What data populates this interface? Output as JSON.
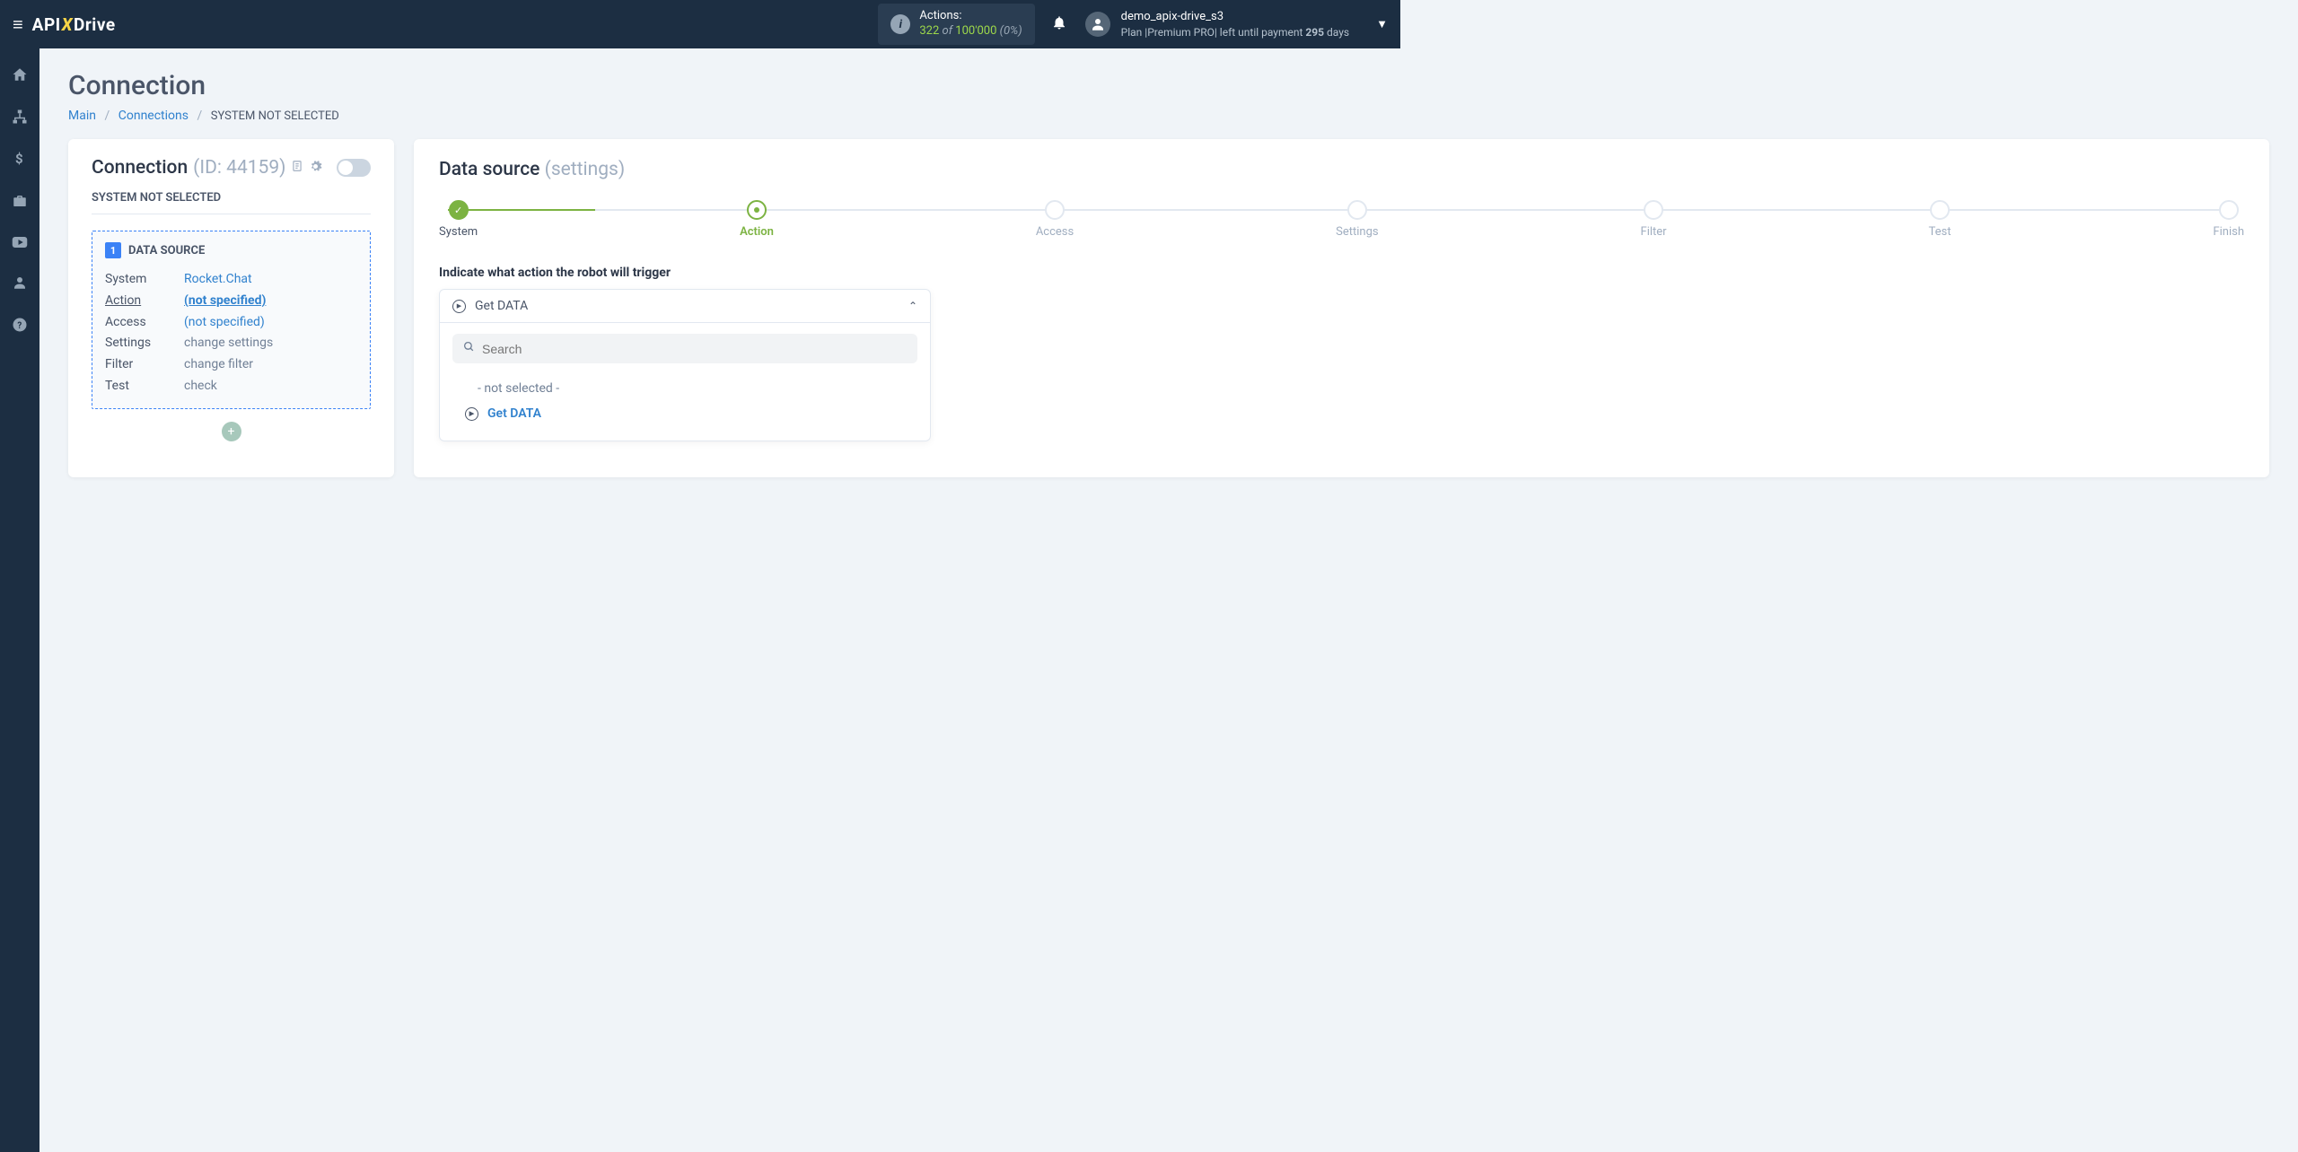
{
  "header": {
    "logo_prefix": "API",
    "logo_x": "X",
    "logo_suffix": "Drive",
    "actions_label": "Actions:",
    "actions_value": "322",
    "actions_of": "of",
    "actions_limit": "100'000",
    "actions_pct": "(0%)",
    "user_name": "demo_apix-drive_s3",
    "plan_prefix": "Plan |",
    "plan_name": "Premium PRO",
    "plan_mid": "| left until payment ",
    "plan_days": "295",
    "plan_days_suffix": " days"
  },
  "page": {
    "title": "Connection",
    "breadcrumb": {
      "main": "Main",
      "connections": "Connections",
      "current": "SYSTEM NOT SELECTED"
    }
  },
  "left": {
    "heading": "Connection",
    "id_text": "(ID: 44159)",
    "subhead": "SYSTEM NOT SELECTED",
    "box_title": "DATA SOURCE",
    "box_num": "1",
    "rows": [
      {
        "k": "System",
        "v": "Rocket.Chat",
        "link": true,
        "active": false
      },
      {
        "k": "Action",
        "v": "(not specified)",
        "link": true,
        "active": true
      },
      {
        "k": "Access",
        "v": "(not specified)",
        "link": true,
        "active": false
      },
      {
        "k": "Settings",
        "v": "change settings",
        "link": false,
        "active": false
      },
      {
        "k": "Filter",
        "v": "change filter",
        "link": false,
        "active": false
      },
      {
        "k": "Test",
        "v": "check",
        "link": false,
        "active": false
      }
    ]
  },
  "right": {
    "title": "Data source",
    "title_sub": "(settings)",
    "steps": [
      "System",
      "Action",
      "Access",
      "Settings",
      "Filter",
      "Test",
      "Finish"
    ],
    "prompt": "Indicate what action the robot will trigger",
    "dd_selected": "Get DATA",
    "search_placeholder": "Search",
    "opt_placeholder": "- not selected -",
    "opt_item": "Get DATA"
  }
}
